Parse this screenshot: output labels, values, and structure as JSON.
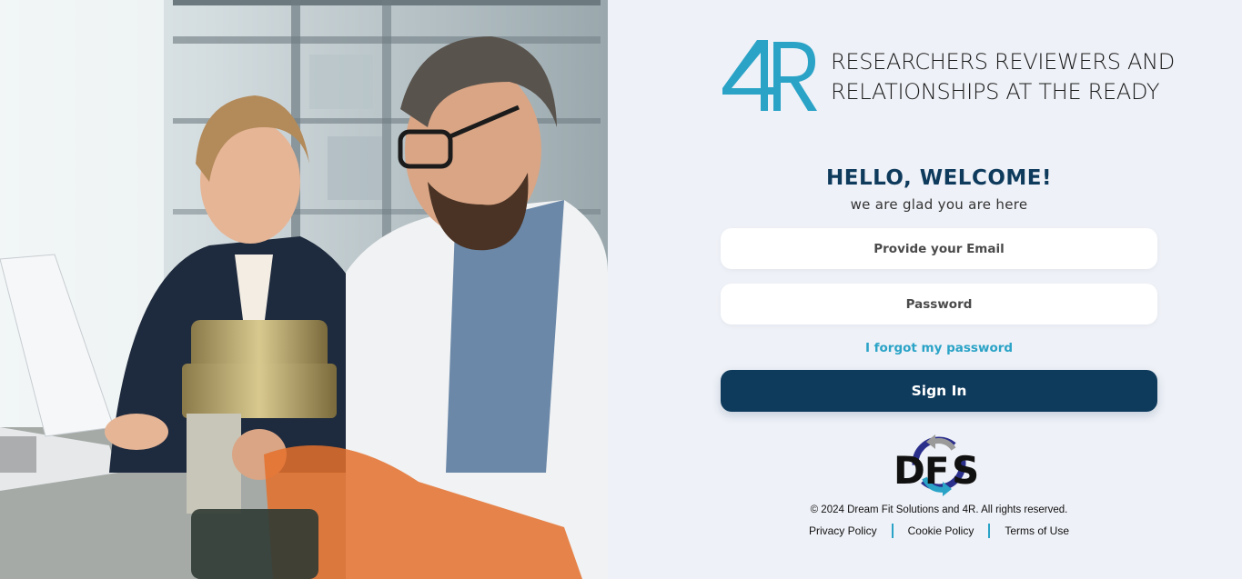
{
  "brand": {
    "logo_text": "4R",
    "tagline_line1": "RESEARCHERS REVIEWERS AND",
    "tagline_line2": "RELATIONSHIPS AT THE READY",
    "accent_color": "#2aa3c7"
  },
  "login": {
    "heading": "HELLO, WELCOME!",
    "subheading": "we are glad you are here",
    "email_placeholder": "Provide your Email",
    "password_placeholder": "Password",
    "forgot_link": "I forgot my password",
    "submit_label": "Sign In",
    "primary_color": "#0e3a5c"
  },
  "footer": {
    "partner_logo_text": "DFS",
    "copyright": "© 2024 Dream Fit Solutions and 4R. All rights reserved.",
    "links": [
      {
        "label": "Privacy Policy"
      },
      {
        "label": "Cookie Policy"
      },
      {
        "label": "Terms of Use"
      }
    ]
  },
  "hero_image": {
    "icon": "lab-researchers-photo"
  }
}
